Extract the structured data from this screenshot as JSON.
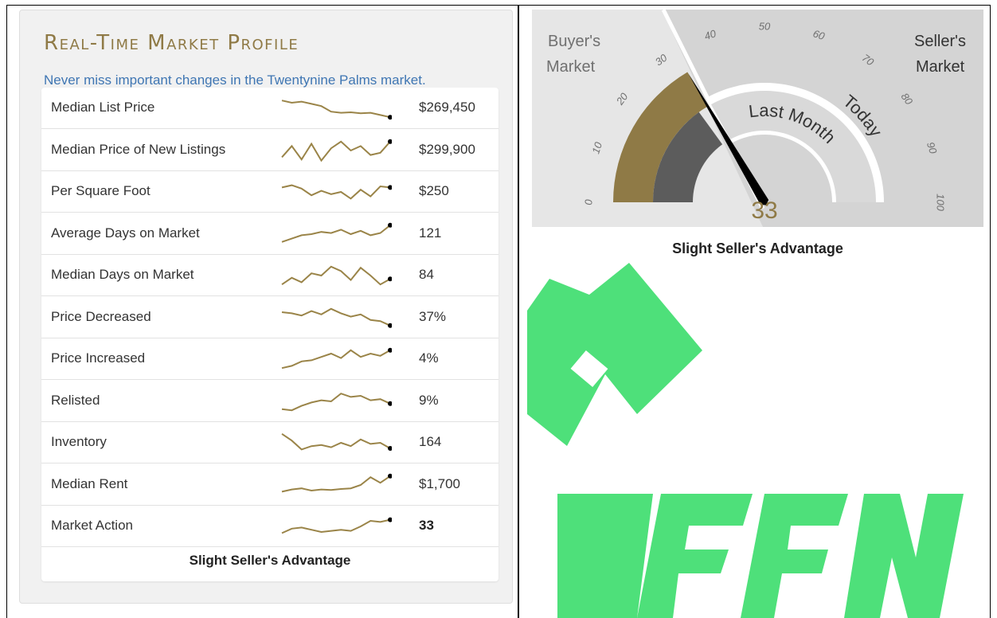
{
  "colors": {
    "accent": "#8f7a46",
    "link": "#3f76b3",
    "sparkline": "#9a8448",
    "watermark": "#4ee07a"
  },
  "panel": {
    "title": "Real-Time Market Profile",
    "subtitle": "Never miss important changes in the Twentynine Palms market."
  },
  "rows": [
    {
      "label": "Median List Price",
      "value": "$269,450",
      "trend": [
        0.85,
        0.75,
        0.8,
        0.7,
        0.6,
        0.35,
        0.3,
        0.32,
        0.28,
        0.3,
        0.2,
        0.1
      ]
    },
    {
      "label": "Median Price of New Listings",
      "value": "$299,900",
      "trend": [
        0.2,
        0.7,
        0.1,
        0.8,
        0.05,
        0.6,
        0.9,
        0.5,
        0.7,
        0.3,
        0.4,
        0.9
      ]
    },
    {
      "label": "Per Square Foot",
      "value": "$250",
      "trend": [
        0.7,
        0.8,
        0.65,
        0.35,
        0.55,
        0.4,
        0.5,
        0.2,
        0.6,
        0.3,
        0.75,
        0.7
      ]
    },
    {
      "label": "Average Days on Market",
      "value": "121",
      "trend": [
        0.15,
        0.3,
        0.45,
        0.5,
        0.6,
        0.55,
        0.7,
        0.5,
        0.65,
        0.45,
        0.55,
        0.9
      ]
    },
    {
      "label": "Median Days on Market",
      "value": "84",
      "trend": [
        0.1,
        0.4,
        0.2,
        0.6,
        0.5,
        0.9,
        0.7,
        0.3,
        0.85,
        0.5,
        0.1,
        0.35
      ]
    },
    {
      "label": "Price Decreased",
      "value": "37%",
      "trend": [
        0.75,
        0.7,
        0.6,
        0.8,
        0.65,
        0.9,
        0.7,
        0.55,
        0.65,
        0.4,
        0.35,
        0.15
      ]
    },
    {
      "label": "Price Increased",
      "value": "4%",
      "trend": [
        0.1,
        0.2,
        0.4,
        0.45,
        0.6,
        0.75,
        0.55,
        0.9,
        0.6,
        0.75,
        0.65,
        0.9
      ]
    },
    {
      "label": "Relisted",
      "value": "9%",
      "trend": [
        0.15,
        0.1,
        0.3,
        0.45,
        0.55,
        0.5,
        0.85,
        0.7,
        0.75,
        0.55,
        0.6,
        0.4
      ]
    },
    {
      "label": "Inventory",
      "value": "164",
      "trend": [
        0.9,
        0.6,
        0.2,
        0.35,
        0.4,
        0.3,
        0.5,
        0.35,
        0.65,
        0.45,
        0.5,
        0.25
      ]
    },
    {
      "label": "Median Rent",
      "value": "$1,700",
      "trend": [
        0.2,
        0.3,
        0.35,
        0.25,
        0.3,
        0.28,
        0.32,
        0.35,
        0.5,
        0.85,
        0.6,
        0.9
      ]
    },
    {
      "label": "Market Action",
      "value": "33",
      "trend": [
        0.2,
        0.4,
        0.45,
        0.35,
        0.25,
        0.3,
        0.35,
        0.3,
        0.5,
        0.75,
        0.7,
        0.8
      ],
      "bold": true
    }
  ],
  "market_action_summary": "Slight Seller's Advantage",
  "gauge": {
    "buyers_label": [
      "Buyer's",
      "Market"
    ],
    "sellers_label": [
      "Seller's",
      "Market"
    ],
    "ticks": [
      "0",
      "10",
      "20",
      "30",
      "40",
      "50",
      "60",
      "70",
      "80",
      "90",
      "100"
    ],
    "last_month_label": "Last Month",
    "today_label": "Today",
    "value": 33,
    "value_text": "33",
    "caption": "Slight Seller's Advantage"
  }
}
